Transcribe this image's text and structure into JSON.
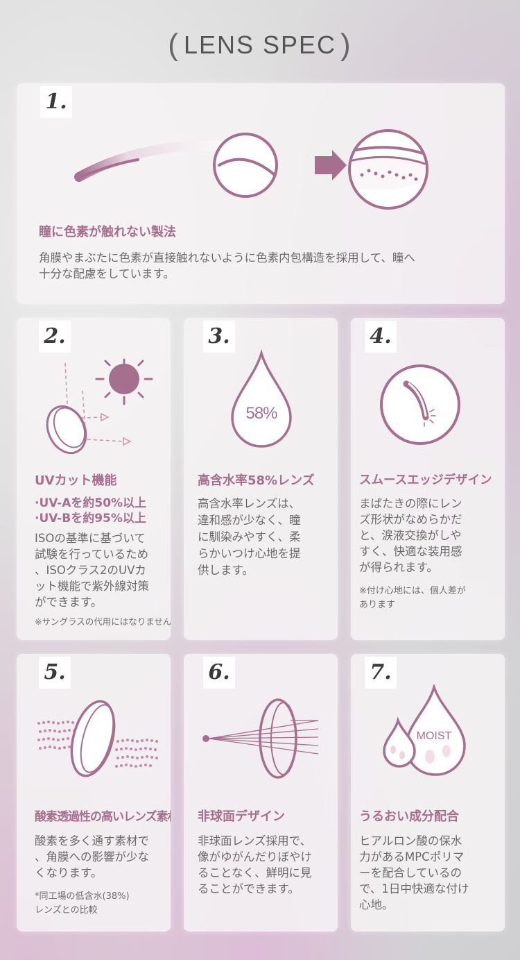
{
  "page_title": "LENS SPEC",
  "colors": {
    "accent": "#a76f8e",
    "card": "#f6f3f5",
    "text": "#6b6b6b"
  },
  "cards": [
    {
      "num": "1.",
      "heading": "瞳に色素が触れない製法",
      "body_lines": [
        "角膜やまぶたに色素が直接触れないように色素内包構造を採用して、瞳へ",
        "十分な配慮をしています。"
      ],
      "icon": "lens-cross-section-icon"
    },
    {
      "num": "2.",
      "heading": "UVカット機能",
      "highlights": [
        "·UV-Aを約50%以上",
        "·UV-Bを約95%以上"
      ],
      "body_lines": [
        "ISOの基準に基づいて",
        "試験を行っているため",
        "、ISOクラス2のUVカ",
        "ット機能で紫外線対策",
        "ができます。"
      ],
      "note": "※サングラスの代用にはなりません",
      "icon": "sun-uv-icon"
    },
    {
      "num": "3.",
      "heading": "高含水率58%レンズ",
      "icon_label": "58%",
      "body_lines": [
        "高含水率レンズは、",
        "違和感が少なく、瞳",
        "に馴染みやすく、柔",
        "らかいつけ心地を提",
        "供します。"
      ],
      "icon": "water-drop-icon"
    },
    {
      "num": "4.",
      "heading": "スムースエッジデザイン",
      "body_lines": [
        "まばたきの際にレン",
        "ズ形状がなめらかだ",
        "と、涙液交換がしや",
        "すく、快適な装用感",
        "が得られます。"
      ],
      "note_lines": [
        "※付け心地には、個人差が",
        "あります"
      ],
      "icon": "smooth-edge-icon"
    },
    {
      "num": "5.",
      "heading": "酸素透過性の高いレンズ素材",
      "body_lines": [
        "酸素を多く通す素材で",
        "、角膜への影響が少な",
        "くなります。"
      ],
      "note_lines": [
        "*同工場の低含水(38%)",
        "レンズとの比較"
      ],
      "icon": "oxygen-lens-icon"
    },
    {
      "num": "6.",
      "heading": "非球面デザイン",
      "body_lines": [
        "非球面レンズ採用で、",
        "像がゆがんだりぼやけ",
        "ることなく、鮮明に見",
        "ることができます。"
      ],
      "icon": "aspheric-lens-icon"
    },
    {
      "num": "7.",
      "heading": "うるおい成分配合",
      "icon_label": "MOIST",
      "body_lines": [
        "ヒアルロン酸の保水",
        "力があるMPCポリマ",
        "ーを配合しているの",
        "で、1日中快適な付け",
        "心地。"
      ],
      "icon": "moist-drops-icon"
    }
  ]
}
